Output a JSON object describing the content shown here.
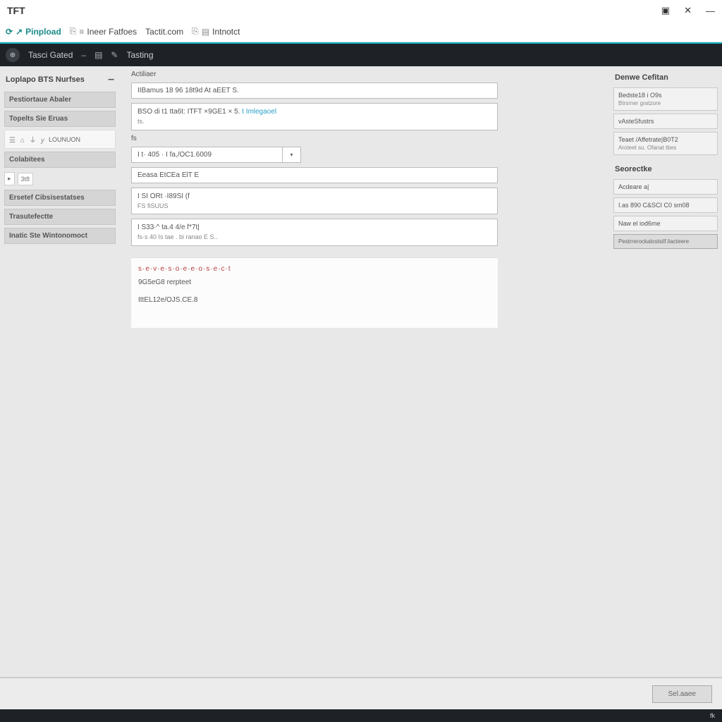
{
  "titlebar": {
    "title": "TFT"
  },
  "tabs": [
    {
      "icon": "⟳",
      "label": "Pinpload",
      "kind": "progress"
    },
    {
      "icon": "⎘",
      "sicon": "≡",
      "label": "Ineer Fatfoes"
    },
    {
      "icon": "",
      "label": "Tactit.com"
    },
    {
      "icon": "⎘",
      "sicon": "▤",
      "label": "Intnotct"
    }
  ],
  "darkbar": {
    "brand_icon": "⊕",
    "label1": "Tasci Gated",
    "label2": "Tasting"
  },
  "left": {
    "title": "Loplapo BTS Nurfses",
    "sections": [
      {
        "kind": "head",
        "label": "Pestiortaue Abaler"
      },
      {
        "kind": "head",
        "label": "Topelts Sie Eruas"
      },
      {
        "kind": "icons",
        "label": "LOUNUON",
        "icons": "☰ ⌂ ⏚ 𝑦"
      },
      {
        "kind": "head",
        "label": "Colabitees"
      },
      {
        "kind": "bread",
        "icon": "▸",
        "label": "3t8"
      },
      {
        "kind": "head",
        "label": "Ersetef Cibsisestatses"
      },
      {
        "kind": "head",
        "label": "Trasutefectte"
      },
      {
        "kind": "head",
        "label": "Inatic Ste Wintonomoct"
      }
    ]
  },
  "center": {
    "top_label": "Actiliaer",
    "field1": "IIBamus 18 96 18t9d At aEET S.",
    "field2_pre": "BSO di t1 tta6t: ITFT ×9GE1 × 5.",
    "field2_link": "t Imlegaoel",
    "field2_sub": "ts.",
    "field3_label": "fs",
    "field3": "I t· 405 · I fa,/OC1.6009",
    "field4": "Eeasa EtCEa ElT E",
    "field5_l1": "I SI ORt ·I89SI (f",
    "field5_l2": "FS fiSUUS",
    "field6_l1": "I S33·^ ta.4 4/e f*7t|",
    "field6_l2": "fs·s 40 Is tae . bi ranao   E  S..",
    "result_err": "s·e·v·e·s·o·e·e·o·s·e·c·t",
    "result_r1": "9G5eG8 rerpteet",
    "result_r2": "IttEL12e/OJS.CE.8"
  },
  "right": {
    "title": "Denwe Cefitan",
    "box1_l1": "Bedste18 i O9s",
    "box1_l2": "Btrsrner gratzore",
    "box2": "vAsteSfustrs",
    "box3_l1": "Teaet /Affetrate|B0T2",
    "box3_l2": "Aroteet su. Ofanat tbes",
    "sec2_title": "Seorectke",
    "box4": "Acdeare a|",
    "box5": "I.as 890 C&SCI C0 sm08",
    "box6": "Naw el iod6me",
    "button": "Pestrrerockalostsilf.liacteere"
  },
  "bottom": {
    "button": "Sel.aaee"
  },
  "footer": {
    "text": "fk"
  }
}
